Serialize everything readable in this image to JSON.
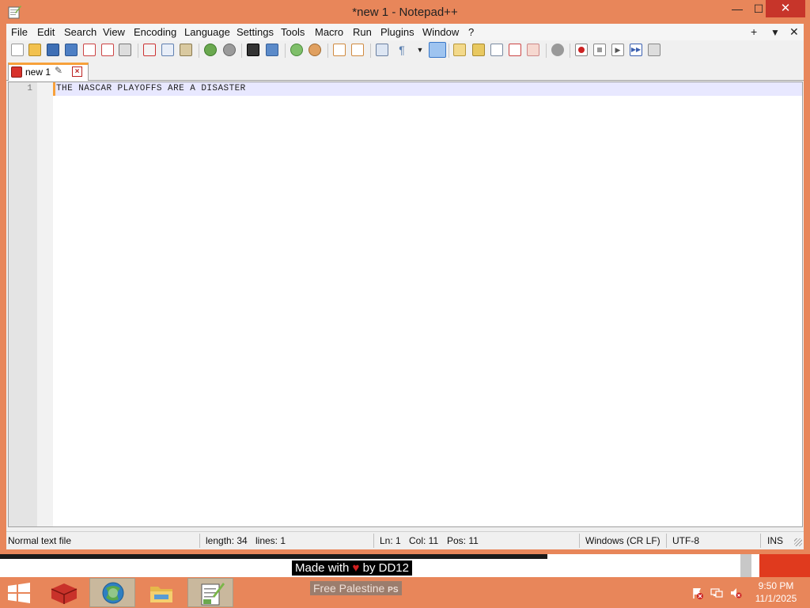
{
  "window": {
    "title": "*new 1 - Notepad++",
    "min_glyph": "—",
    "max_glyph": "☐",
    "close_glyph": "✕"
  },
  "menu": {
    "items": [
      "File",
      "Edit",
      "Search",
      "View",
      "Encoding",
      "Language",
      "Settings",
      "Tools",
      "Macro",
      "Run",
      "Plugins",
      "Window",
      "?"
    ],
    "right_plus": "+",
    "right_down": "▼",
    "right_close": "✕"
  },
  "toolbar": {
    "icons": [
      "new-file-icon",
      "open-file-icon",
      "save-icon",
      "save-all-icon",
      "close-icon",
      "close-all-icon",
      "print-icon",
      "cut-icon",
      "copy-icon",
      "paste-icon",
      "undo-icon",
      "redo-icon",
      "find-icon",
      "replace-icon",
      "zoom-in-icon",
      "zoom-out-icon",
      "sync-v-icon",
      "sync-h-icon",
      "word-wrap-icon",
      "show-all-chars-icon",
      "indent-guide-icon",
      "udl-icon",
      "doc-map-icon",
      "function-list-icon",
      "folder-workspace-icon",
      "monitoring-icon",
      "record-macro-icon",
      "stop-macro-icon",
      "play-macro-icon",
      "run-macro-multiple-icon",
      "save-macro-icon"
    ]
  },
  "tabs": [
    {
      "label": "new 1",
      "pin_glyph": "✎",
      "close_glyph": "×"
    }
  ],
  "editor": {
    "lines": [
      {
        "number": "1",
        "text": "THE NASCAR PLAYOFFS ARE A DISASTER"
      }
    ]
  },
  "status": {
    "file_type": "Normal text file",
    "length": "length: 34",
    "lines": "lines: 1",
    "ln": "Ln: 1",
    "col": "Col: 11",
    "pos": "Pos: 11",
    "eol": "Windows (CR LF)",
    "encoding": "UTF-8",
    "mode": "INS"
  },
  "overlay": {
    "made_with_prefix": "Made with",
    "heart": "♥",
    "made_with_suffix": "by DD12",
    "free_palestine": "Free Palestine",
    "free_palestine_tag": "PS"
  },
  "taskbar": {
    "time": "9:50 PM",
    "date": "11/1/2025"
  },
  "colors": {
    "accent": "#e8865a",
    "tab_highlight": "#f7a13b",
    "close_red": "#c7352a"
  }
}
